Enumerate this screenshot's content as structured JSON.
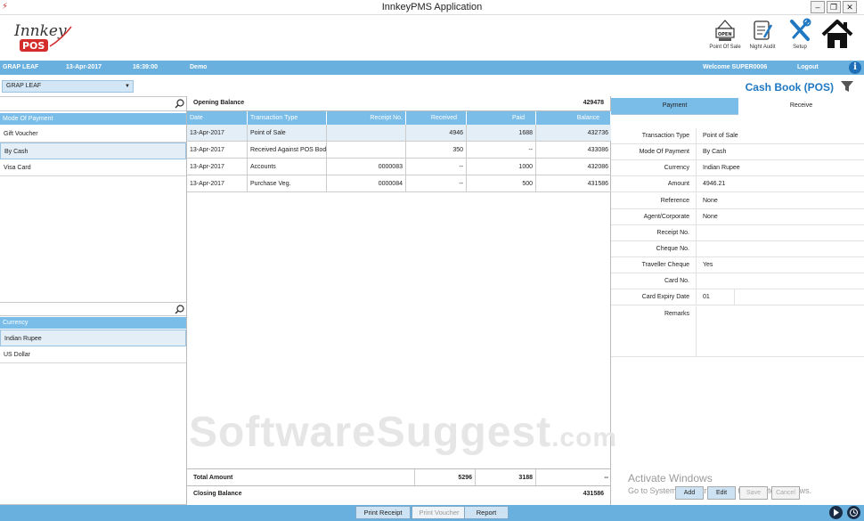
{
  "window": {
    "title": "InnkeyPMS Application",
    "minimize": "–",
    "restore": "❐",
    "close": "✕"
  },
  "header": {
    "logo_text": "Innkey",
    "logo_sub": "POS",
    "icons": [
      {
        "name": "point-of-sale",
        "label": "Point Of Sale",
        "badge": "OPEN"
      },
      {
        "name": "night-audit",
        "label": "Night Audit"
      },
      {
        "name": "setup",
        "label": "Setup"
      },
      {
        "name": "home",
        "label": ""
      }
    ]
  },
  "infobar": {
    "property": "GRAP LEAF",
    "date": "13-Apr-2017",
    "time": "16:39:00",
    "mode": "Demo",
    "welcome": "Welcome SUPER0006",
    "logout": "Logout",
    "info": "i"
  },
  "branch": {
    "selected": "GRAP LEAF"
  },
  "page_title": "Cash Book (POS)",
  "payment_modes": {
    "header": "Mode Of Payment",
    "items": [
      "Gift Voucher",
      "By Cash",
      "Visa Card"
    ],
    "selected_index": 1
  },
  "currencies": {
    "header": "Currency",
    "items": [
      "Indian Rupee",
      "US Dollar"
    ],
    "selected_index": 0
  },
  "grid": {
    "opening_label": "Opening Balance",
    "opening_value": "429478",
    "columns": [
      "Date",
      "Transaction Type",
      "Receipt No.",
      "Received",
      "Paid",
      "Balance"
    ],
    "rows": [
      [
        "13-Apr-2017",
        "Point of Sale",
        "",
        "4946",
        "1688",
        "432736"
      ],
      [
        "13-Apr-2017",
        "Received Against POS Bod",
        "",
        "350",
        "--",
        "433086"
      ],
      [
        "13-Apr-2017",
        "Accounts",
        "0000083",
        "--",
        "1000",
        "432086"
      ],
      [
        "13-Apr-2017",
        "Purchase Veg.",
        "0000084",
        "--",
        "500",
        "431586"
      ]
    ],
    "selected_row": 0,
    "total_label": "Total Amount",
    "total_received": "5296",
    "total_paid": "3188",
    "total_balance": "--",
    "closing_label": "Closing Balance",
    "closing_value": "431586"
  },
  "watermark": {
    "main": "SoftwareSuggest",
    "suffix": ".com"
  },
  "detail": {
    "tabs": [
      "Payment",
      "Receive"
    ],
    "active_tab": "Receive",
    "fields": [
      {
        "label": "Transaction Type",
        "value": "Point of Sale"
      },
      {
        "label": "Mode Of Payment",
        "value": "By Cash"
      },
      {
        "label": "Currency",
        "value": "Indian Rupee"
      },
      {
        "label": "Amount",
        "value": "4946.21"
      },
      {
        "label": "Reference",
        "value": "None"
      },
      {
        "label": "Agent/Corporate",
        "value": "None"
      },
      {
        "label": "Receipt No.",
        "value": ""
      },
      {
        "label": "Cheque No.",
        "value": ""
      },
      {
        "label": "Traveller Cheque",
        "value": "Yes"
      },
      {
        "label": "Card No.",
        "value": ""
      },
      {
        "label": "Card Expiry Date",
        "value": "01"
      },
      {
        "label": "Remarks",
        "value": ""
      }
    ]
  },
  "activate_windows": {
    "line1": "Activate Windows",
    "line2": "Go to System in Control Panel to activate Windows."
  },
  "actions": {
    "add": "Add",
    "edit": "Edit",
    "save": "Save",
    "cancel": "Cancel"
  },
  "bottom": {
    "print_receipt": "Print Receipt",
    "print_voucher": "Print Voucher",
    "report": "Report"
  },
  "colors": {
    "accent": "#6ab0de",
    "header_blue": "#79bde8",
    "title_blue": "#1f78c1"
  }
}
